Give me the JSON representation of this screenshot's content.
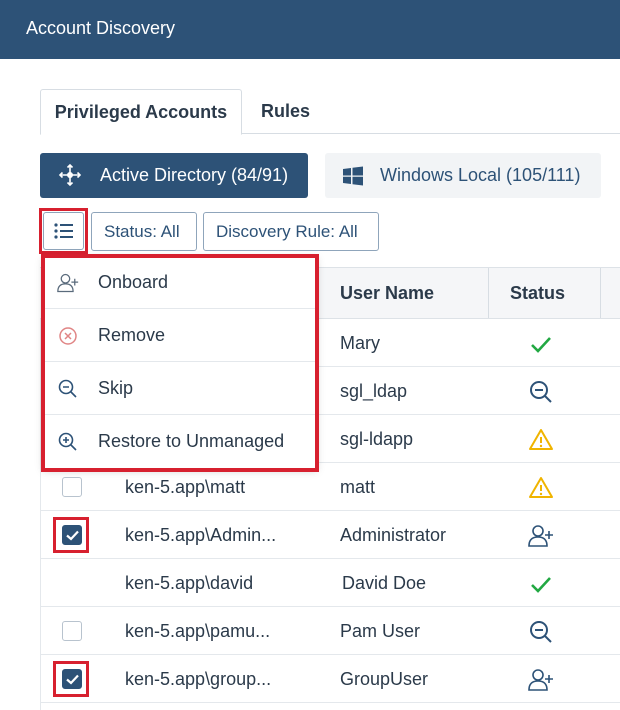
{
  "header": {
    "title": "Account Discovery"
  },
  "tabs": [
    {
      "label": "Privileged Accounts",
      "active": true
    },
    {
      "label": "Rules",
      "active": false
    }
  ],
  "sources": {
    "active_directory": {
      "label": "Active Directory (84/91)",
      "icon": "network-icon"
    },
    "windows_local": {
      "label": "Windows Local (105/111)",
      "icon": "windows-icon"
    }
  },
  "toolbar": {
    "list_icon": "list-icon",
    "status_filter": "Status: All",
    "rule_filter": "Discovery Rule: All"
  },
  "menu": {
    "items": [
      {
        "label": "Onboard",
        "icon": "user-plus-icon"
      },
      {
        "label": "Remove",
        "icon": "remove-circle-icon"
      },
      {
        "label": "Skip",
        "icon": "zoom-out-icon"
      },
      {
        "label": "Restore to Unmanaged",
        "icon": "zoom-in-icon"
      }
    ]
  },
  "table": {
    "columns": {
      "user_name": "User Name",
      "status": "Status"
    },
    "rows": [
      {
        "account": "",
        "user": "Mary",
        "status": "check"
      },
      {
        "account": "",
        "user": "sgl_ldap",
        "status": "skip"
      },
      {
        "account": "",
        "user": "sgl-ldapp",
        "status": "warning"
      },
      {
        "account": "ken-5.app\\matt",
        "user": "matt",
        "status": "warning",
        "checked": false
      },
      {
        "account": "ken-5.app\\Admin...",
        "user": "Administrator",
        "status": "onboard",
        "checked": true
      },
      {
        "account": "ken-5.app\\david",
        "user": "David Doe",
        "status": "check"
      },
      {
        "account": "ken-5.app\\pamu...",
        "user": "Pam User",
        "status": "skip",
        "checked": false
      },
      {
        "account": "ken-5.app\\group...",
        "user": "GroupUser",
        "status": "onboard",
        "checked": true
      }
    ]
  },
  "colors": {
    "primary": "#2d5277",
    "highlight": "#d7202f",
    "success": "#22a843",
    "warning": "#f0b400"
  }
}
